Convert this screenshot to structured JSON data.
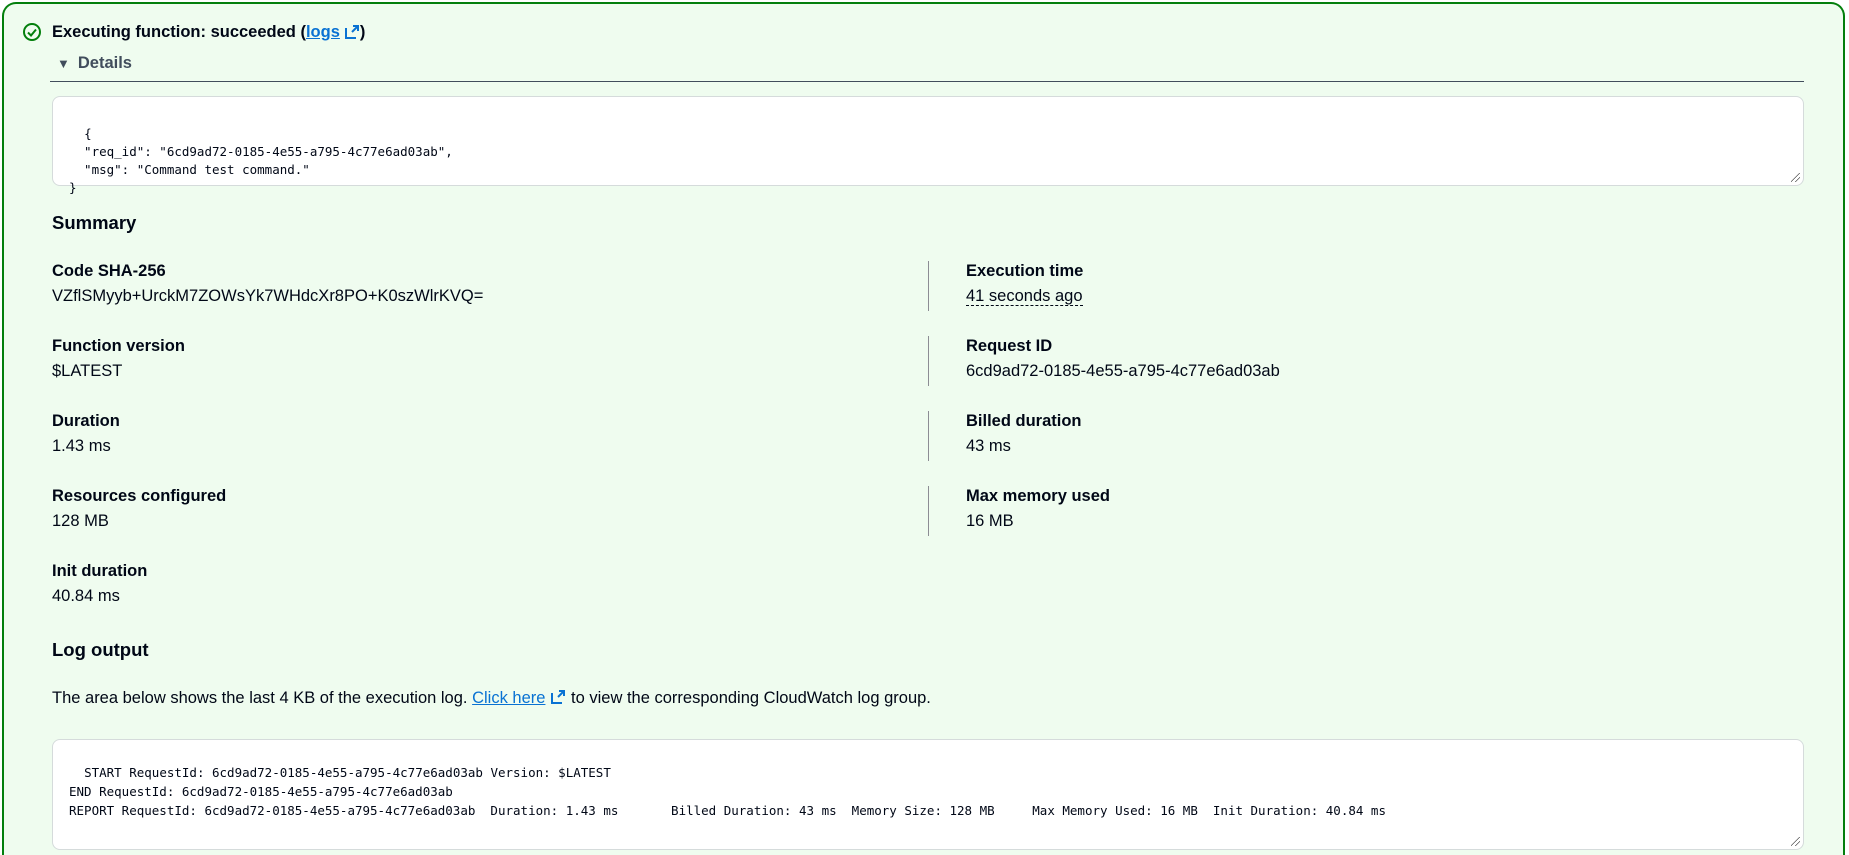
{
  "header": {
    "title_prefix": "Executing function: succeeded (",
    "logs_link": "logs",
    "title_suffix": ")",
    "status_color": "#037f0c"
  },
  "details": {
    "label": "Details",
    "response": "{\n  \"req_id\": \"6cd9ad72-0185-4e55-a795-4c77e6ad03ab\",\n  \"msg\": \"Command test command.\"\n}"
  },
  "summary": {
    "heading": "Summary",
    "left": [
      {
        "label": "Code SHA-256",
        "value": "VZflSMyyb+UrckM7ZOWsYk7WHdcXr8PO+K0szWlrKVQ="
      },
      {
        "label": "Function version",
        "value": "$LATEST"
      },
      {
        "label": "Duration",
        "value": "1.43 ms"
      },
      {
        "label": "Resources configured",
        "value": "128 MB"
      },
      {
        "label": "Init duration",
        "value": "40.84 ms"
      }
    ],
    "right": [
      {
        "label": "Execution time",
        "value": "41 seconds ago"
      },
      {
        "label": "Request ID",
        "value": "6cd9ad72-0185-4e55-a795-4c77e6ad03ab"
      },
      {
        "label": "Billed duration",
        "value": "43 ms"
      },
      {
        "label": "Max memory used",
        "value": "16 MB"
      }
    ]
  },
  "log": {
    "heading": "Log output",
    "text_before": "The area below shows the last 4 KB of the execution log. ",
    "link": "Click here",
    "text_after": " to view the corresponding CloudWatch log group.",
    "content": "START RequestId: 6cd9ad72-0185-4e55-a795-4c77e6ad03ab Version: $LATEST\nEND RequestId: 6cd9ad72-0185-4e55-a795-4c77e6ad03ab\nREPORT RequestId: 6cd9ad72-0185-4e55-a795-4c77e6ad03ab  Duration: 1.43 ms       Billed Duration: 43 ms  Memory Size: 128 MB     Max Memory Used: 16 MB  Init Duration: 40.84 ms"
  }
}
